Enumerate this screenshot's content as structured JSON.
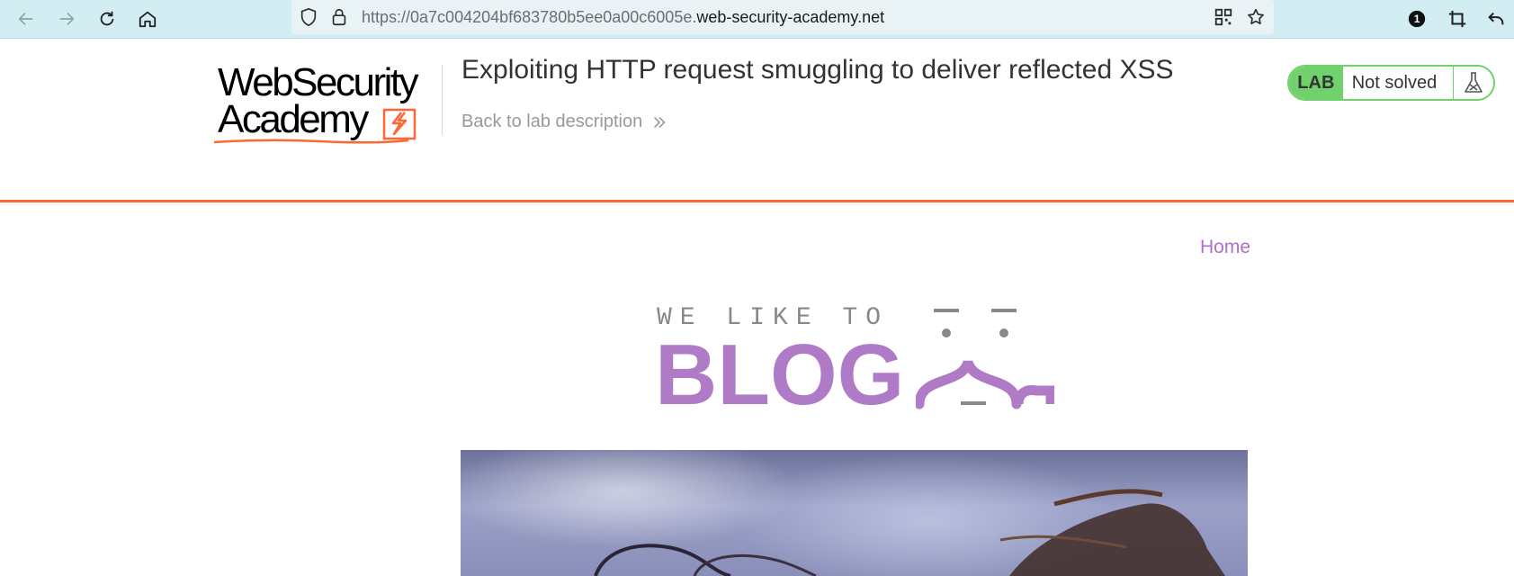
{
  "browser": {
    "url_prefix": "https://0a7c004204bf683780b5ee0a00c6005e.",
    "url_domain": "web-security-academy.net",
    "notification_count": "1"
  },
  "lab_header": {
    "logo_line1": "WebSecurity",
    "logo_line2": "Academy",
    "title": "Exploiting HTTP request smuggling to deliver reflected XSS",
    "back_link": "Back to lab description",
    "status_label": "LAB",
    "status_value": "Not solved",
    "colors": {
      "accent_orange": "#ff6633",
      "status_green": "#70d16d"
    }
  },
  "blog": {
    "nav_home": "Home",
    "tagline": "WE LIKE TO",
    "wordmark": "BLOG",
    "accent_color": "#b07bc6"
  }
}
